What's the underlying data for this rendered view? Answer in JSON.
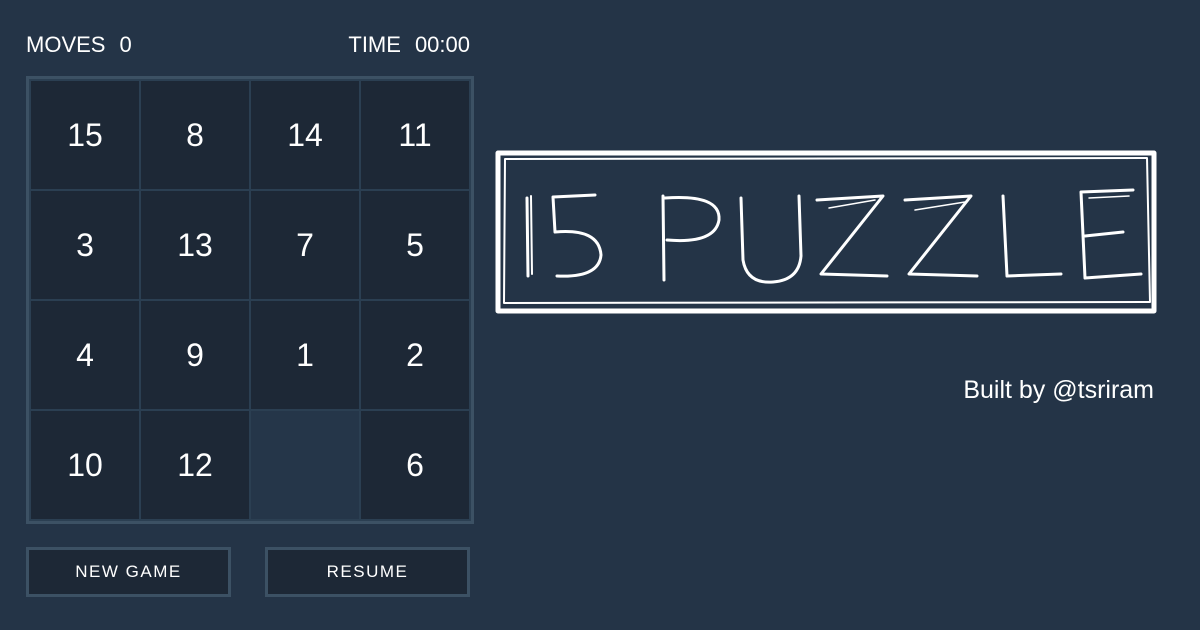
{
  "stats": {
    "moves_label": "MOVES",
    "moves_value": "0",
    "time_label": "TIME",
    "time_value": "00:00"
  },
  "board": {
    "tiles": [
      "15",
      "8",
      "14",
      "11",
      "3",
      "13",
      "7",
      "5",
      "4",
      "9",
      "1",
      "2",
      "10",
      "12",
      "",
      "6"
    ]
  },
  "buttons": {
    "new_game": "NEW GAME",
    "resume": "RESUME"
  },
  "logo": {
    "text": "15 PUZZLE"
  },
  "credit": "Built by @tsriram",
  "colors": {
    "background": "#243447",
    "tile": "#1d2836",
    "empty_tile": "#253649",
    "border": "#3c5164",
    "text": "#ffffff"
  }
}
